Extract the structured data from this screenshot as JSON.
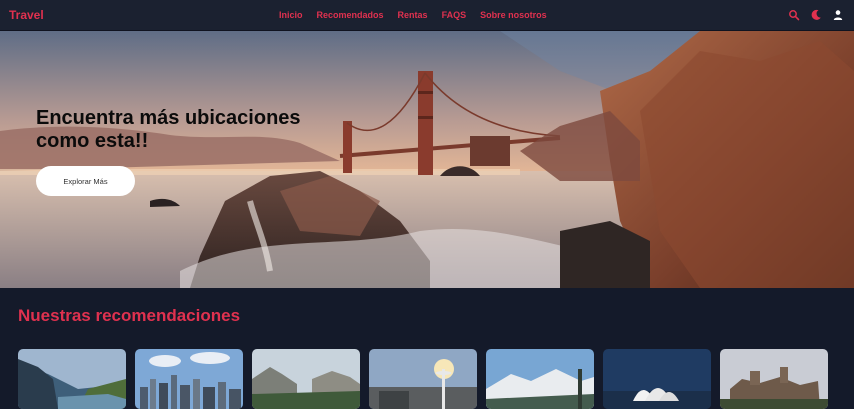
{
  "brand": "Travel",
  "nav": {
    "items": [
      "Inicio",
      "Recomendados",
      "Rentas",
      "FAQS",
      "Sobre nosotros"
    ],
    "icons": [
      "search-icon",
      "moon-icon",
      "user-icon"
    ]
  },
  "hero": {
    "title": "Encuentra más ubicaciones como esta!!",
    "button_label": "Explorar Más"
  },
  "recommendations": {
    "title": "Nuestras recomendaciones"
  },
  "colors": {
    "accent": "#e0314f",
    "navbar_bg": "#1b2130",
    "page_bg": "#141a2a"
  }
}
